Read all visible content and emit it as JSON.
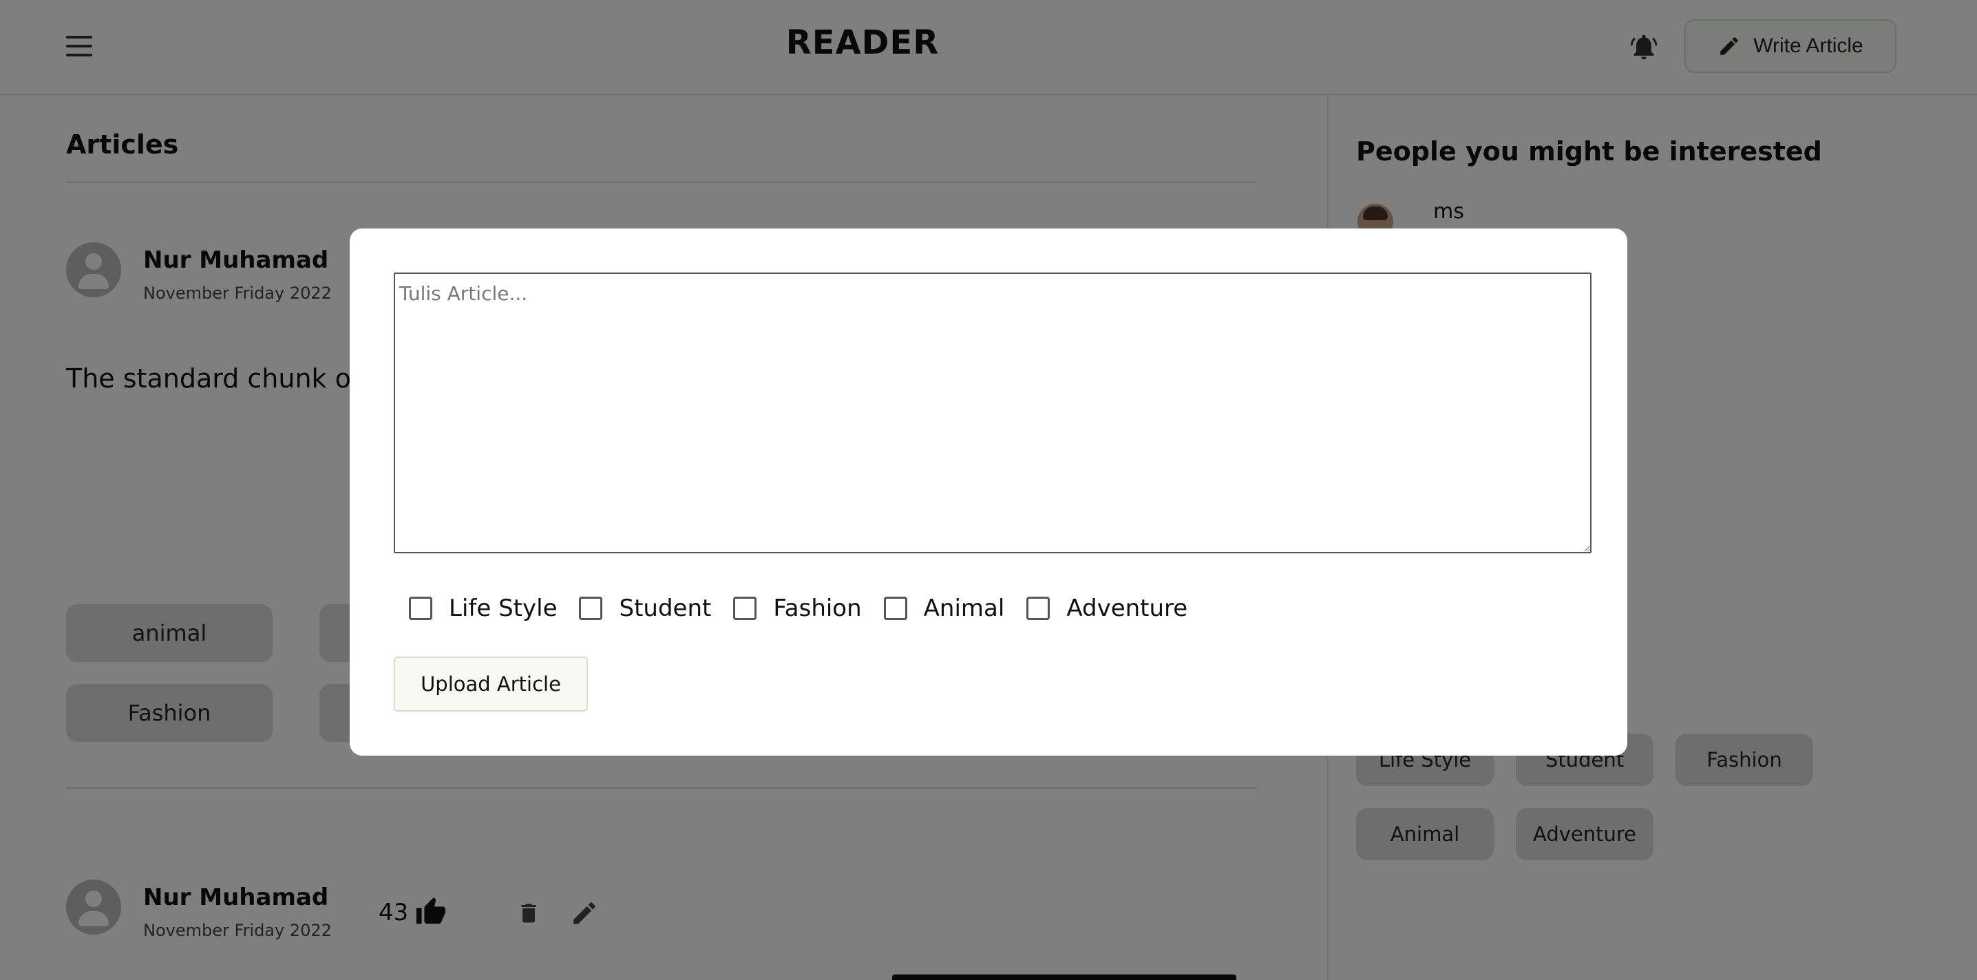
{
  "header": {
    "brand": "READER",
    "write_button_label": "Write Article"
  },
  "articles": {
    "section_title": "Articles",
    "posts": [
      {
        "author": "Nur Muhamad",
        "date": "November Friday 2022",
        "snippet": "The standard chunk of",
        "tags": [
          "animal",
          "Fashion"
        ]
      },
      {
        "author": "Nur Muhamad",
        "date": "November Friday 2022",
        "likes": "43"
      }
    ]
  },
  "sidebar": {
    "title": "People you might be interested",
    "people": [
      {
        "name": "ms"
      }
    ],
    "tags": [
      "Life Style",
      "Student",
      "Fashion",
      "Animal",
      "Adventure"
    ]
  },
  "modal": {
    "textarea_placeholder": "Tulis Article...",
    "categories": [
      "Life Style",
      "Student",
      "Fashion",
      "Animal",
      "Adventure"
    ],
    "upload_button_label": "Upload Article"
  }
}
